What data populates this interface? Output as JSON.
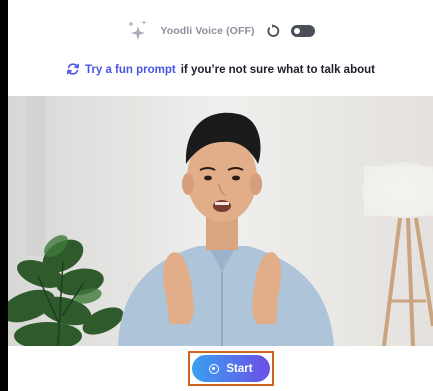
{
  "voice": {
    "label": "Yoodli Voice (OFF)",
    "toggle_state": "off"
  },
  "prompt": {
    "link_text": "Try a fun prompt",
    "rest_text": "if you’re not sure what to talk about"
  },
  "controls": {
    "start_label": "Start"
  },
  "colors": {
    "accent": "#4a56e2",
    "button_gradient_start": "#3aa0f0",
    "button_gradient_end": "#6b4fe6",
    "focus_outline": "#d0641c"
  },
  "icons": {
    "sparkle": "sparkle-icon",
    "reset": "reset-icon",
    "refresh": "refresh-icon",
    "record": "record-icon"
  }
}
